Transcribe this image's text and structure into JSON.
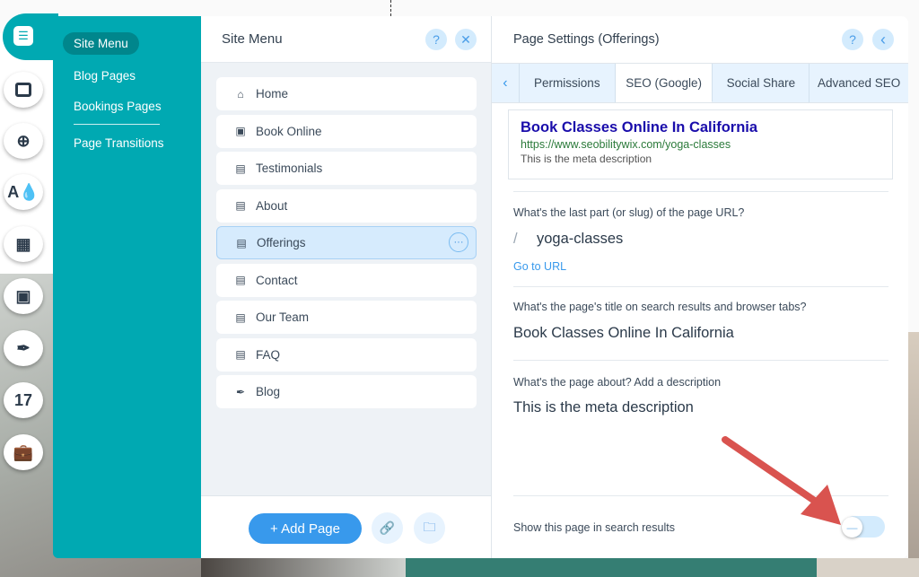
{
  "left_tools": [
    "pages-icon",
    "background-icon",
    "add-icon",
    "design-icon",
    "add-apps-icon",
    "media-icon",
    "blog-pen-icon",
    "bookings-calendar-icon",
    "business-briefcase-icon"
  ],
  "teal_menu": {
    "items": [
      "Site Menu",
      "Blog Pages",
      "Bookings Pages",
      "Page Transitions"
    ],
    "active": "Site Menu"
  },
  "site_menu": {
    "title": "Site Menu",
    "help": "?",
    "close": "✕",
    "pages": [
      {
        "label": "Home",
        "icon": "home-icon"
      },
      {
        "label": "Book Online",
        "icon": "calendar-icon"
      },
      {
        "label": "Testimonials",
        "icon": "page-icon"
      },
      {
        "label": "About",
        "icon": "page-icon"
      },
      {
        "label": "Offerings",
        "icon": "page-icon",
        "selected": true
      },
      {
        "label": "Contact",
        "icon": "page-icon"
      },
      {
        "label": "Our Team",
        "icon": "page-icon"
      },
      {
        "label": "FAQ",
        "icon": "page-icon"
      },
      {
        "label": "Blog",
        "icon": "pen-icon"
      }
    ],
    "more": "···",
    "add_page": "+ Add Page"
  },
  "page_settings": {
    "title": "Page Settings (Offerings)",
    "help": "?",
    "back": "‹",
    "tabs_prev": "‹",
    "tabs": [
      "Permissions",
      "SEO (Google)",
      "Social Share",
      "Advanced SEO"
    ],
    "active_tab": "SEO (Google)",
    "preview": {
      "title": "Book Classes Online In California",
      "url": "https://www.seobilitywix.com/yoga-classes",
      "description": "This is the meta description"
    },
    "slug_label": "What's the last part (or slug) of the page URL?",
    "slug_prefix": "/",
    "slug": "yoga-classes",
    "go_to_url": "Go to URL",
    "title_label": "What's the page's title on search results and browser tabs?",
    "title_value": "Book Classes Online In California",
    "desc_label": "What's the page about? Add a description",
    "desc_value": "This is the meta description",
    "show_in_search_label": "Show this page in search results",
    "show_in_search": false
  },
  "colors": {
    "teal": "#00a9b2",
    "accent": "#3899ec",
    "annotation_arrow": "#d9534f"
  }
}
